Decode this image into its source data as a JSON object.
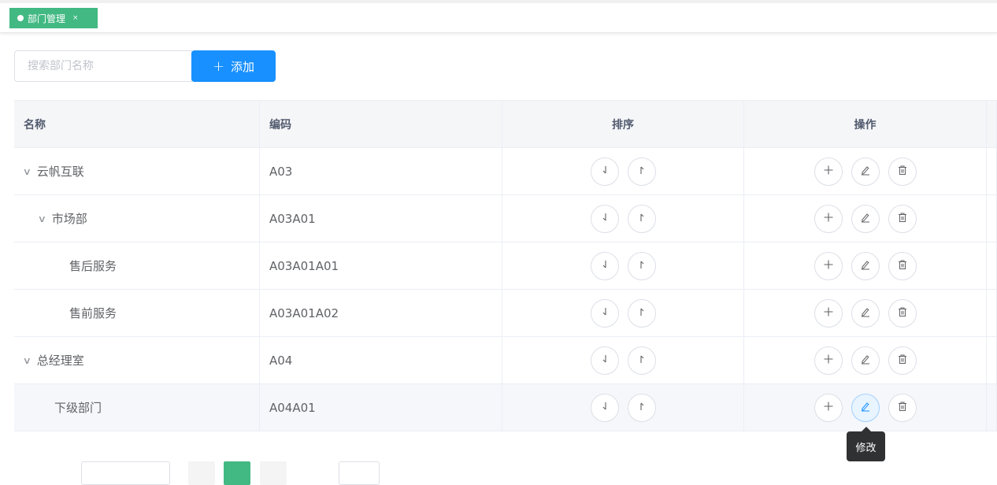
{
  "tabs": [
    {
      "label": "部门管理",
      "close": "×"
    }
  ],
  "search": {
    "placeholder": "搜索部门名称"
  },
  "add_button": {
    "plus": "+",
    "label": "添加"
  },
  "table": {
    "headers": {
      "name": "名称",
      "code": "编码",
      "sort": "排序",
      "ops": "操作"
    },
    "rows": [
      {
        "name": "云帆互联",
        "code": "A03",
        "level": 0,
        "expandable": true
      },
      {
        "name": "市场部",
        "code": "A03A01",
        "level": 1,
        "expandable": true
      },
      {
        "name": "售后服务",
        "code": "A03A01A01",
        "level": 2,
        "expandable": false
      },
      {
        "name": "售前服务",
        "code": "A03A01A02",
        "level": 2,
        "expandable": false
      },
      {
        "name": "总经理室",
        "code": "A04",
        "level": 0,
        "expandable": true
      },
      {
        "name": "下级部门",
        "code": "A04A01",
        "level": 1,
        "expandable": false
      }
    ]
  },
  "tooltip": {
    "text": "修改"
  },
  "icons": {
    "expand": "chevron-down-icon",
    "sort_down": "arrow-down-icon",
    "sort_up": "arrow-up-icon",
    "add": "plus-icon",
    "edit": "edit-pencil-icon",
    "delete": "trash-icon"
  },
  "colors": {
    "accent_green": "#42b983",
    "primary_blue": "#1890ff",
    "tooltip_bg": "#303133"
  }
}
